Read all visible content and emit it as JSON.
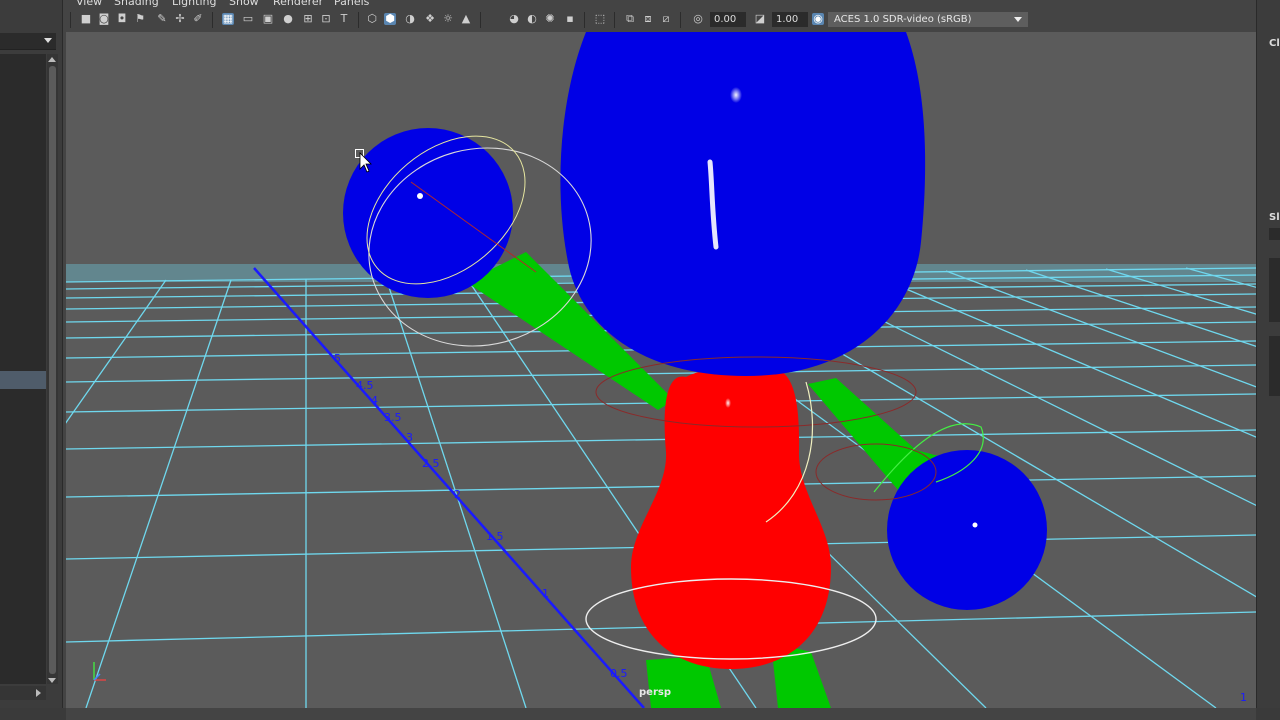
{
  "menu": {
    "items": [
      "View",
      "Shading",
      "Lighting",
      "Show",
      "Renderer",
      "Panels"
    ]
  },
  "toolbar": {
    "exposure_value": "0.00",
    "gamma_value": "1.00",
    "color_space": "ACES 1.0 SDR-video (sRGB)"
  },
  "viewport": {
    "camera_label": "persp",
    "axis_labels": [
      "5",
      "4.5",
      "4",
      "3.5",
      "3",
      "2.5",
      "2",
      "1.5",
      "1",
      "0.5"
    ],
    "corner_label": "1"
  },
  "right_panel": {
    "label_top": "Cl",
    "label_mid": "Sl"
  },
  "colors": {
    "head": "#0000e6",
    "body": "#ff0000",
    "limbs": "#00c800",
    "grid": "#6fd8ee",
    "axis": "#1a1aff",
    "viewport_bg": "#5b5b5b"
  }
}
